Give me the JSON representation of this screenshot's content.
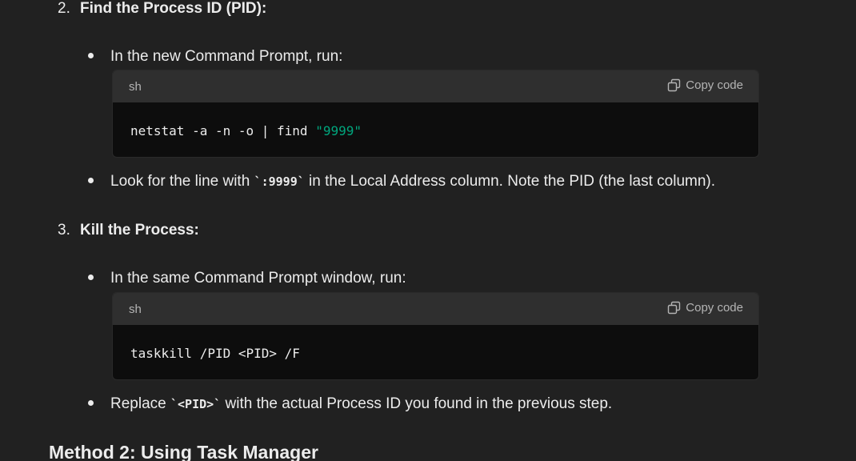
{
  "steps": [
    {
      "num": "2.",
      "title": "Find the Process ID (PID):"
    },
    {
      "num": "3.",
      "title": "Kill the Process:"
    }
  ],
  "bullets": {
    "b1": {
      "text": "In the new Command Prompt, run:"
    },
    "b2": {
      "before": "Look for the line with ",
      "code": "`:9999`",
      "after": " in the Local Address column. Note the PID (the last column)."
    },
    "b3": {
      "text": "In the same Command Prompt window, run:"
    },
    "b4": {
      "before": "Replace ",
      "code": "`<PID>`",
      "after": " with the actual Process ID you found in the previous step."
    }
  },
  "code_blocks": [
    {
      "lang": "sh",
      "copy_label": "Copy code",
      "code_plain": "netstat -a -n -o | find ",
      "code_string": "\"9999\""
    },
    {
      "lang": "sh",
      "copy_label": "Copy code",
      "code_plain": "taskkill /PID <PID> /F",
      "code_string": ""
    }
  ],
  "method_heading": "Method 2: Using Task Manager",
  "colors": {
    "background": "#212121",
    "code_header": "#2f2f2f",
    "code_body": "#0d0d0d",
    "string_token": "#00a67d"
  },
  "icons": {
    "copy": "copy-icon",
    "bullet": "bullet-dot"
  }
}
